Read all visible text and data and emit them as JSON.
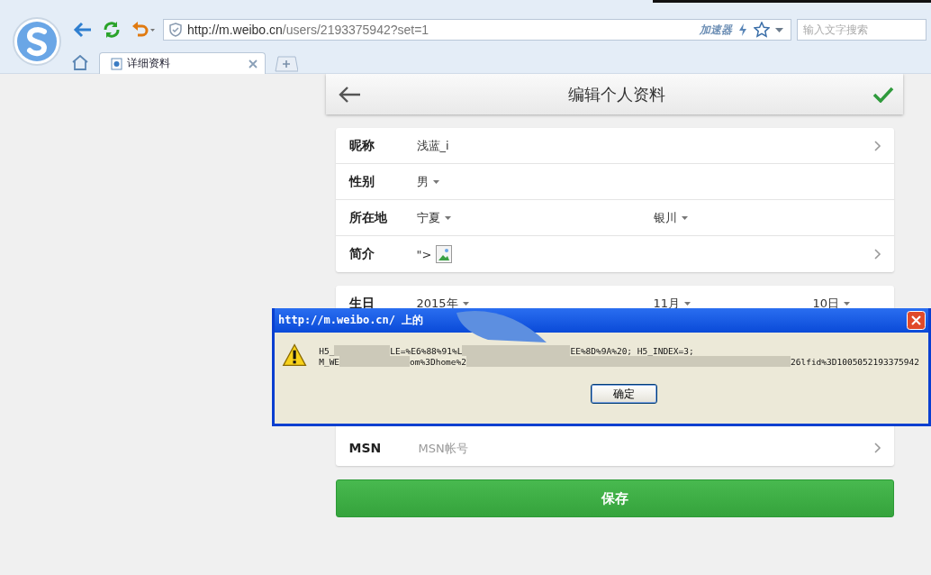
{
  "browser": {
    "address_host": "http://m.weibo.cn",
    "address_path": "/users/2193375942?set=1",
    "accelerator": "加速器",
    "search": {
      "placeholder": "输入文字搜索"
    },
    "tabs": [
      {
        "label": "详细资料",
        "selected": true
      }
    ]
  },
  "page": {
    "title": "编辑个人资料"
  },
  "profile": [
    {
      "label": "昵称",
      "kind": "text",
      "values": [
        "浅蓝_i"
      ]
    },
    {
      "label": "性别",
      "kind": "select",
      "values": [
        "男"
      ]
    },
    {
      "label": "所在地",
      "kind": "select",
      "values": [
        "宁夏",
        "银川"
      ]
    },
    {
      "label": "简介",
      "kind": "html",
      "values": [
        "\">"
      ]
    }
  ],
  "birthday": {
    "label": "生日",
    "values": [
      "2015年",
      "11月",
      "10日"
    ]
  },
  "msn": {
    "label": "MSN",
    "placeholder": "MSN帐号"
  },
  "save": "保存",
  "dialog": {
    "title": "http://m.weibo.cn/ 上的",
    "lines": [
      [
        "H5_",
        "LE=%E6%88%91%L",
        "EE%8D%9A%20; H5_INDEX=3;"
      ],
      [
        "M_WE",
        "om%3Dhome%2",
        "26lfid%3D1005052193375942"
      ]
    ],
    "button": "确定"
  }
}
